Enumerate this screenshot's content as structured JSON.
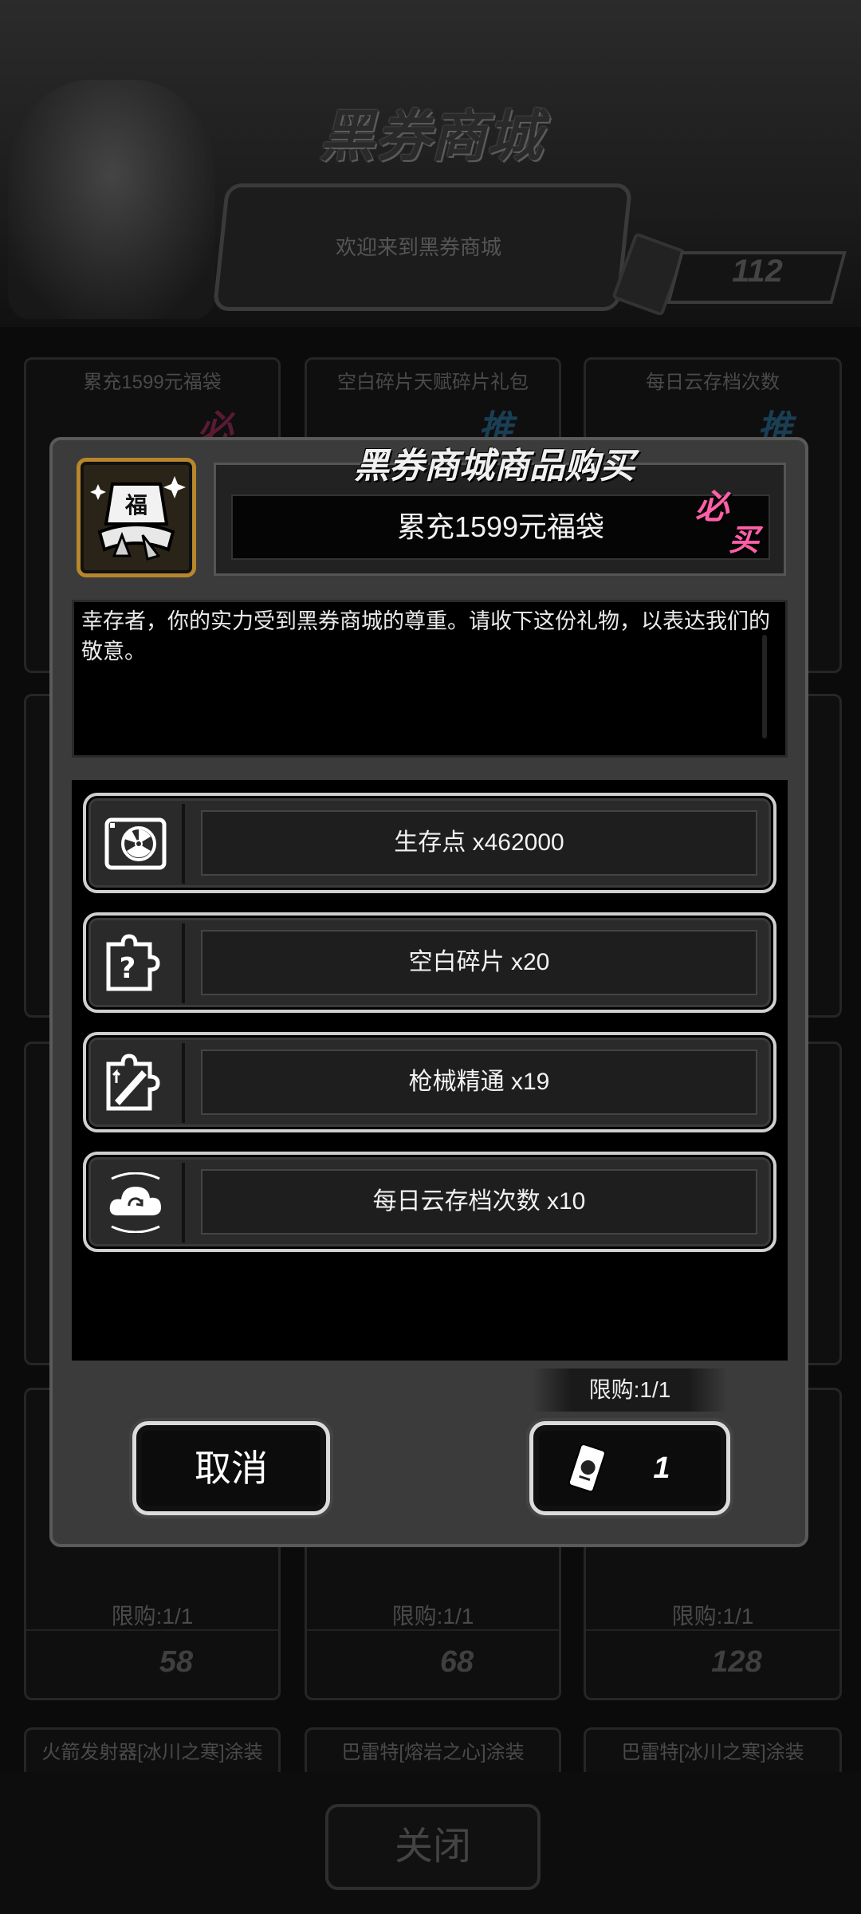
{
  "background": {
    "shop_title": "黑券商城",
    "welcome_text": "欢迎来到黑券商城",
    "ticket_balance": "112",
    "cards_row1": [
      {
        "title": "累充1599元福袋",
        "badge": "必"
      },
      {
        "title": "空白碎片天赋碎片礼包",
        "badge": "推"
      },
      {
        "title": "每日云存档次数",
        "badge": "推"
      }
    ],
    "cards_bottom": [
      {
        "limit": "限购:1/1",
        "price": "58"
      },
      {
        "limit": "限购:1/1",
        "price": "68"
      },
      {
        "limit": "限购:1/1",
        "price": "128"
      }
    ],
    "cards_row_last": [
      {
        "title": "火箭发射器[冰川之寒]涂装"
      },
      {
        "title": "巴雷特[熔岩之心]涂装"
      },
      {
        "title": "巴雷特[冰川之寒]涂装"
      }
    ],
    "close_label": "关闭"
  },
  "modal": {
    "heading": "黑券商城商品购买",
    "item_icon_text": "福",
    "item_name": "累充1599元福袋",
    "badge_line1": "必",
    "badge_line2": "买",
    "description": "幸存者，你的实力受到黑券商城的尊重。请收下这份礼物，以表达我们的敬意。",
    "rewards": [
      {
        "label": "生存点 x462000",
        "icon": "radiation-icon"
      },
      {
        "label": "空白碎片 x20",
        "icon": "puzzle-question-icon"
      },
      {
        "label": "枪械精通 x19",
        "icon": "puzzle-gun-icon"
      },
      {
        "label": "每日云存档次数 x10",
        "icon": "cloud-sync-icon"
      }
    ],
    "cancel_label": "取消",
    "limit_label": "限购:1/1",
    "buy_price": "1"
  },
  "colors": {
    "modal_bg": "#3b3b3b",
    "badge_pink": "#ff5fa8",
    "icon_gold": "#b8862c"
  }
}
